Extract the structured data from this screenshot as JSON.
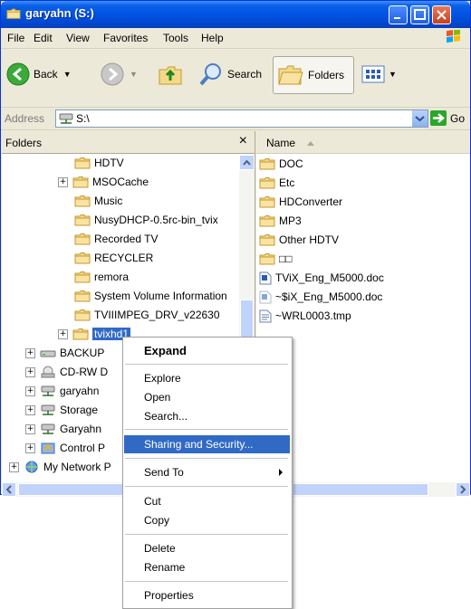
{
  "window": {
    "title": "garyahn (S:)"
  },
  "menubar": {
    "items": [
      "File",
      "Edit",
      "View",
      "Favorites",
      "Tools",
      "Help"
    ]
  },
  "toolbar": {
    "back_label": "Back",
    "search_label": "Search",
    "folders_label": "Folders"
  },
  "address": {
    "label": "Address",
    "value": "S:\\",
    "go_label": "Go"
  },
  "folders_pane": {
    "title": "Folders",
    "tree": [
      "HDTV",
      "MSOCache",
      "Music",
      "NusyDHCP-0.5rc-bin_tvix",
      "Recorded TV",
      "RECYCLER",
      "remora",
      "System Volume Information",
      "TVIIIMPEG_DRV_v22630",
      "tvixhd1",
      "BACKUP",
      "CD-RW D",
      "garyahn",
      "Storage",
      "Garyahn",
      "Control P",
      "My Network P"
    ]
  },
  "file_list": {
    "column_header": "Name",
    "items": [
      "DOC",
      "Etc",
      "HDConverter",
      "MP3",
      "Other HDTV",
      "□□",
      "TViX_Eng_M5000.doc",
      "~$iX_Eng_M5000.doc",
      "~WRL0003.tmp"
    ]
  },
  "context_menu": {
    "items": [
      "Expand",
      "Explore",
      "Open",
      "Search...",
      "Sharing and Security...",
      "Send To",
      "Cut",
      "Copy",
      "Delete",
      "Rename",
      "Properties"
    ],
    "highlighted": "Sharing and Security..."
  },
  "colors": {
    "title_blue": "#0054E3",
    "selection": "#316AC5",
    "chrome": "#ECE9D8",
    "folder": "#F2D27A"
  }
}
